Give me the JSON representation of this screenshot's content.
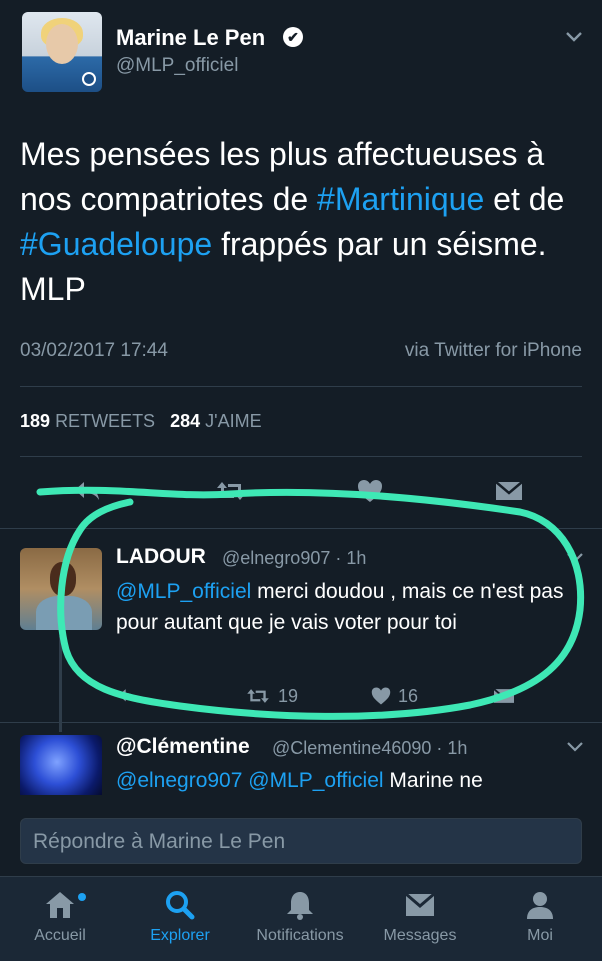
{
  "main_tweet": {
    "author_name": "Marine Le Pen",
    "verified_glyph": "✔",
    "handle": "@MLP_officiel",
    "text_parts": [
      "Mes pensées les plus affectueuses à nos compatriotes de ",
      "#Martinique",
      " et de ",
      "#Guadeloupe",
      " frappés par un séisme. MLP"
    ],
    "date": "03/02/2017 17:44",
    "via": "via Twitter for iPhone",
    "retweets_count": "189",
    "retweets_label": "RETWEETS",
    "likes_count": "284",
    "likes_label": "J'AIME"
  },
  "replies": [
    {
      "name": "LADOUR",
      "handle_time": "@elnegro907 · 1h",
      "mention": "@MLP_officiel",
      "text": " merci doudou , mais ce n'est pas pour autant que je vais voter pour toi",
      "retweets": "19",
      "likes": "16"
    },
    {
      "name": "@Clémentine",
      "handle_time": "@Clementine46090 · 1h",
      "mentions": "@elnegro907 @MLP_officiel",
      "text": " Marine ne"
    }
  ],
  "reply_box": {
    "placeholder": "Répondre à Marine Le Pen"
  },
  "tabs": [
    {
      "label": "Accueil",
      "icon": "home-icon"
    },
    {
      "label": "Explorer",
      "icon": "search-icon"
    },
    {
      "label": "Notifications",
      "icon": "bell-icon"
    },
    {
      "label": "Messages",
      "icon": "envelope-icon"
    },
    {
      "label": "Moi",
      "icon": "person-icon"
    }
  ],
  "colors": {
    "background": "#141d26",
    "accent": "#1da1f2",
    "muted": "#8899a6",
    "marker": "#3ee8b5"
  }
}
